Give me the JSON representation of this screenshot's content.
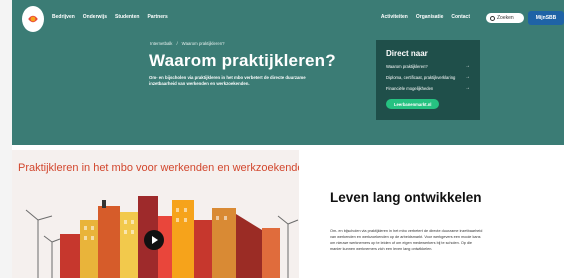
{
  "header": {
    "nav": [
      "Bedrijven",
      "Onderwijs",
      "Studenten",
      "Partners"
    ],
    "right_nav": [
      "Activiteiten",
      "Organisatie",
      "Contact"
    ],
    "search_placeholder": "Zoeken",
    "account_label": "MijnSBB"
  },
  "hero": {
    "breadcrumb": [
      "Internetbalk",
      "Waarom praktijkleren?"
    ],
    "breadcrumb_sep": "/",
    "title": "Waarom praktijkleren?",
    "subtitle": "Om- en bijscholen via praktijkleren in het mbo verbetert de directe duurzame inzetbaarheid van werkenden en werkzoekenden."
  },
  "direct_naar": {
    "title": "Direct naar",
    "links": [
      "Waarom praktijkleren?",
      "Diploma, certificaat, praktijkverklaring",
      "Financiële mogelijkheden"
    ],
    "button": "Leerbanenmarkt.nl"
  },
  "section": {
    "video_title": "Praktijkleren in het mbo voor werkenden en werkzoekenden",
    "heading": "Leven lang ontwikkelen",
    "body": "Om- en bijscholen via praktijkleren in het mbo verbetert de directe duurzame inzetbaarheid van werkenden en werkzoekenden op de arbeidsmarkt. Voor werkgevers een mooie kans om nieuwe werknemers op te leiden of om eigen medewerkers bij te scholen. Op die manier kunnen werknemers zich een leven lang ontwikkelen."
  },
  "colors": {
    "teal": "#3b7c75",
    "dark_teal": "#1f4f4a",
    "green": "#26c281",
    "blue": "#1f63a6",
    "title_red": "#d2472e"
  },
  "icons": [
    "sbb-logo-icon",
    "search-icon",
    "play-icon",
    "arrow-right-icon"
  ]
}
